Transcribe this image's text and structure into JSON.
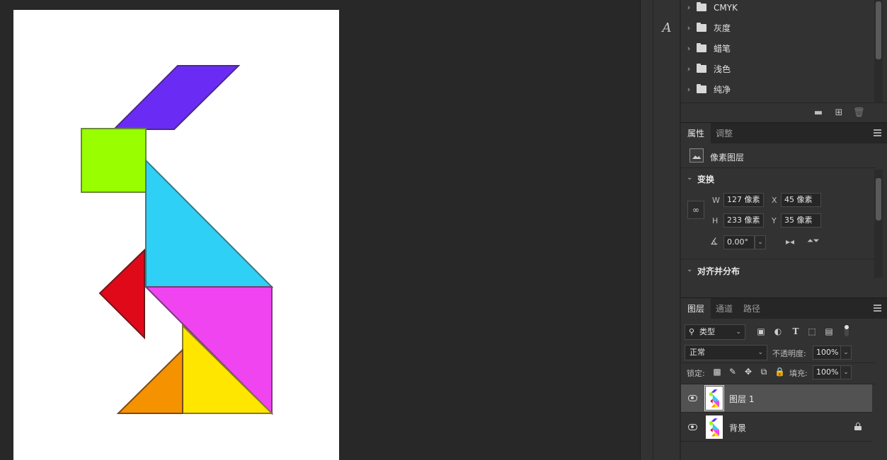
{
  "swatches": {
    "folders": [
      {
        "name": "CMYK"
      },
      {
        "name": "灰度"
      },
      {
        "name": "蜡笔"
      },
      {
        "name": "浅色"
      },
      {
        "name": "纯净"
      }
    ]
  },
  "properties": {
    "tabs": [
      {
        "label": "属性"
      },
      {
        "label": "调整"
      }
    ],
    "layer_type": "像素图层",
    "transform": {
      "title": "变换",
      "w_label": "W",
      "w_value": "127 像素",
      "h_label": "H",
      "h_value": "233 像素",
      "x_label": "X",
      "x_value": "45 像素",
      "y_label": "Y",
      "y_value": "35 像素",
      "angle_value": "0.00°"
    },
    "align_title": "对齐并分布"
  },
  "layers_panel": {
    "tabs": [
      {
        "label": "图层"
      },
      {
        "label": "通道"
      },
      {
        "label": "路径"
      }
    ],
    "filter_kind": "类型",
    "blend_mode": "正常",
    "opacity_label": "不透明度:",
    "opacity_value": "100%",
    "lock_label": "锁定:",
    "fill_label": "填充:",
    "fill_value": "100%",
    "layers": [
      {
        "name": "图层 1",
        "selected": true,
        "visible": true
      },
      {
        "name": "背景",
        "selected": false,
        "visible": true,
        "locked": true
      }
    ]
  },
  "icons": {
    "folder": "folder-icon",
    "new_group": "new-folder-icon",
    "new_item": "plus-square-icon",
    "delete": "trash-icon",
    "panel_menu": "hamburger-menu-icon",
    "type_tool": "character-icon"
  },
  "tangram": {
    "colors": {
      "parallelogram": "#6a2cf5",
      "square": "#99ff00",
      "large_triangle_top": "#2fd0f5",
      "small_triangle_left": "#e0091a",
      "large_triangle_bottom": "#f044f0",
      "yellow_triangle": "#ffe600",
      "orange_triangle": "#f59200"
    }
  }
}
